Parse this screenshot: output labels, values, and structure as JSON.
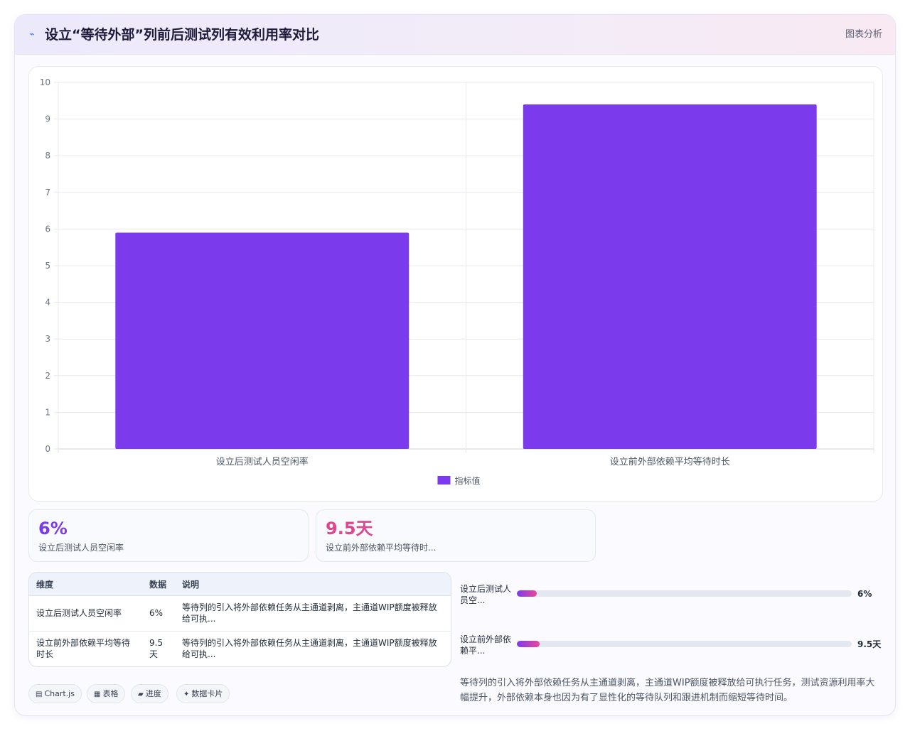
{
  "header": {
    "icon": "chart-line-icon",
    "title": "设立“等待外部”列前后测试列有效利用率对比",
    "tag": "图表分析"
  },
  "chart_data": {
    "type": "bar",
    "categories": [
      "设立后测试人员空闲率",
      "设立前外部依赖平均等待时长"
    ],
    "series": [
      {
        "name": "指标值",
        "values": [
          5.9,
          9.4
        ],
        "color": "#7c3aed"
      }
    ],
    "ylim": [
      0,
      10
    ],
    "yticks": [
      0,
      1,
      2,
      3,
      4,
      5,
      6,
      7,
      8,
      9,
      10
    ],
    "grid": true,
    "legend": "bottom-center",
    "title": "",
    "xlabel": "",
    "ylabel": ""
  },
  "stats": [
    {
      "value": "6%",
      "label": "设立后测试人员空闲率",
      "color": "#7c3aed"
    },
    {
      "value": "9.5天",
      "label": "设立前外部依赖平均等待时...",
      "color": "#e0468e"
    }
  ],
  "table": {
    "headers": [
      "维度",
      "数据",
      "说明"
    ],
    "rows": [
      {
        "dimension": "设立后测试人员空闲率",
        "data": "6%",
        "note_line1": "等待列的引入将外部依赖任务从主通道剥离，主通道WIP额度被释放",
        "note_line2": "给可执..."
      },
      {
        "dimension_line1": "设立前外部依赖平均等待",
        "dimension_line2": "时长",
        "data_line1": "9.5",
        "data_line2": "天",
        "note_line1": "等待列的引入将外部依赖任务从主通道剥离，主通道WIP额度被释放",
        "note_line2": "给可执..."
      }
    ]
  },
  "progress": [
    {
      "label_line1": "设立后测试人",
      "label_line2": "员空...",
      "value_text": "6%",
      "fraction": 0.06
    },
    {
      "label_line1": "设立前外部依",
      "label_line2": "赖平...",
      "value_text": "9.5天",
      "fraction": 0.068
    }
  ],
  "summary": {
    "line1": "等待列的引入将外部依赖任务从主通道剥离，主通道WIP额度被释放给可执行任务，测试资源利用率大",
    "line2": "幅提升，外部依赖本身也因为有了显性化的等待队列和跟进机制而缩短等待时间。"
  },
  "chips": [
    {
      "icon": "chart-icon",
      "glyph": "▤",
      "label": "Chart.js"
    },
    {
      "icon": "table-icon",
      "glyph": "▦",
      "label": "表格"
    },
    {
      "icon": "progress-icon",
      "glyph": "▰",
      "label": "进度"
    },
    {
      "icon": "sparkle-icon",
      "glyph": "✦",
      "label": "数据卡片"
    }
  ]
}
